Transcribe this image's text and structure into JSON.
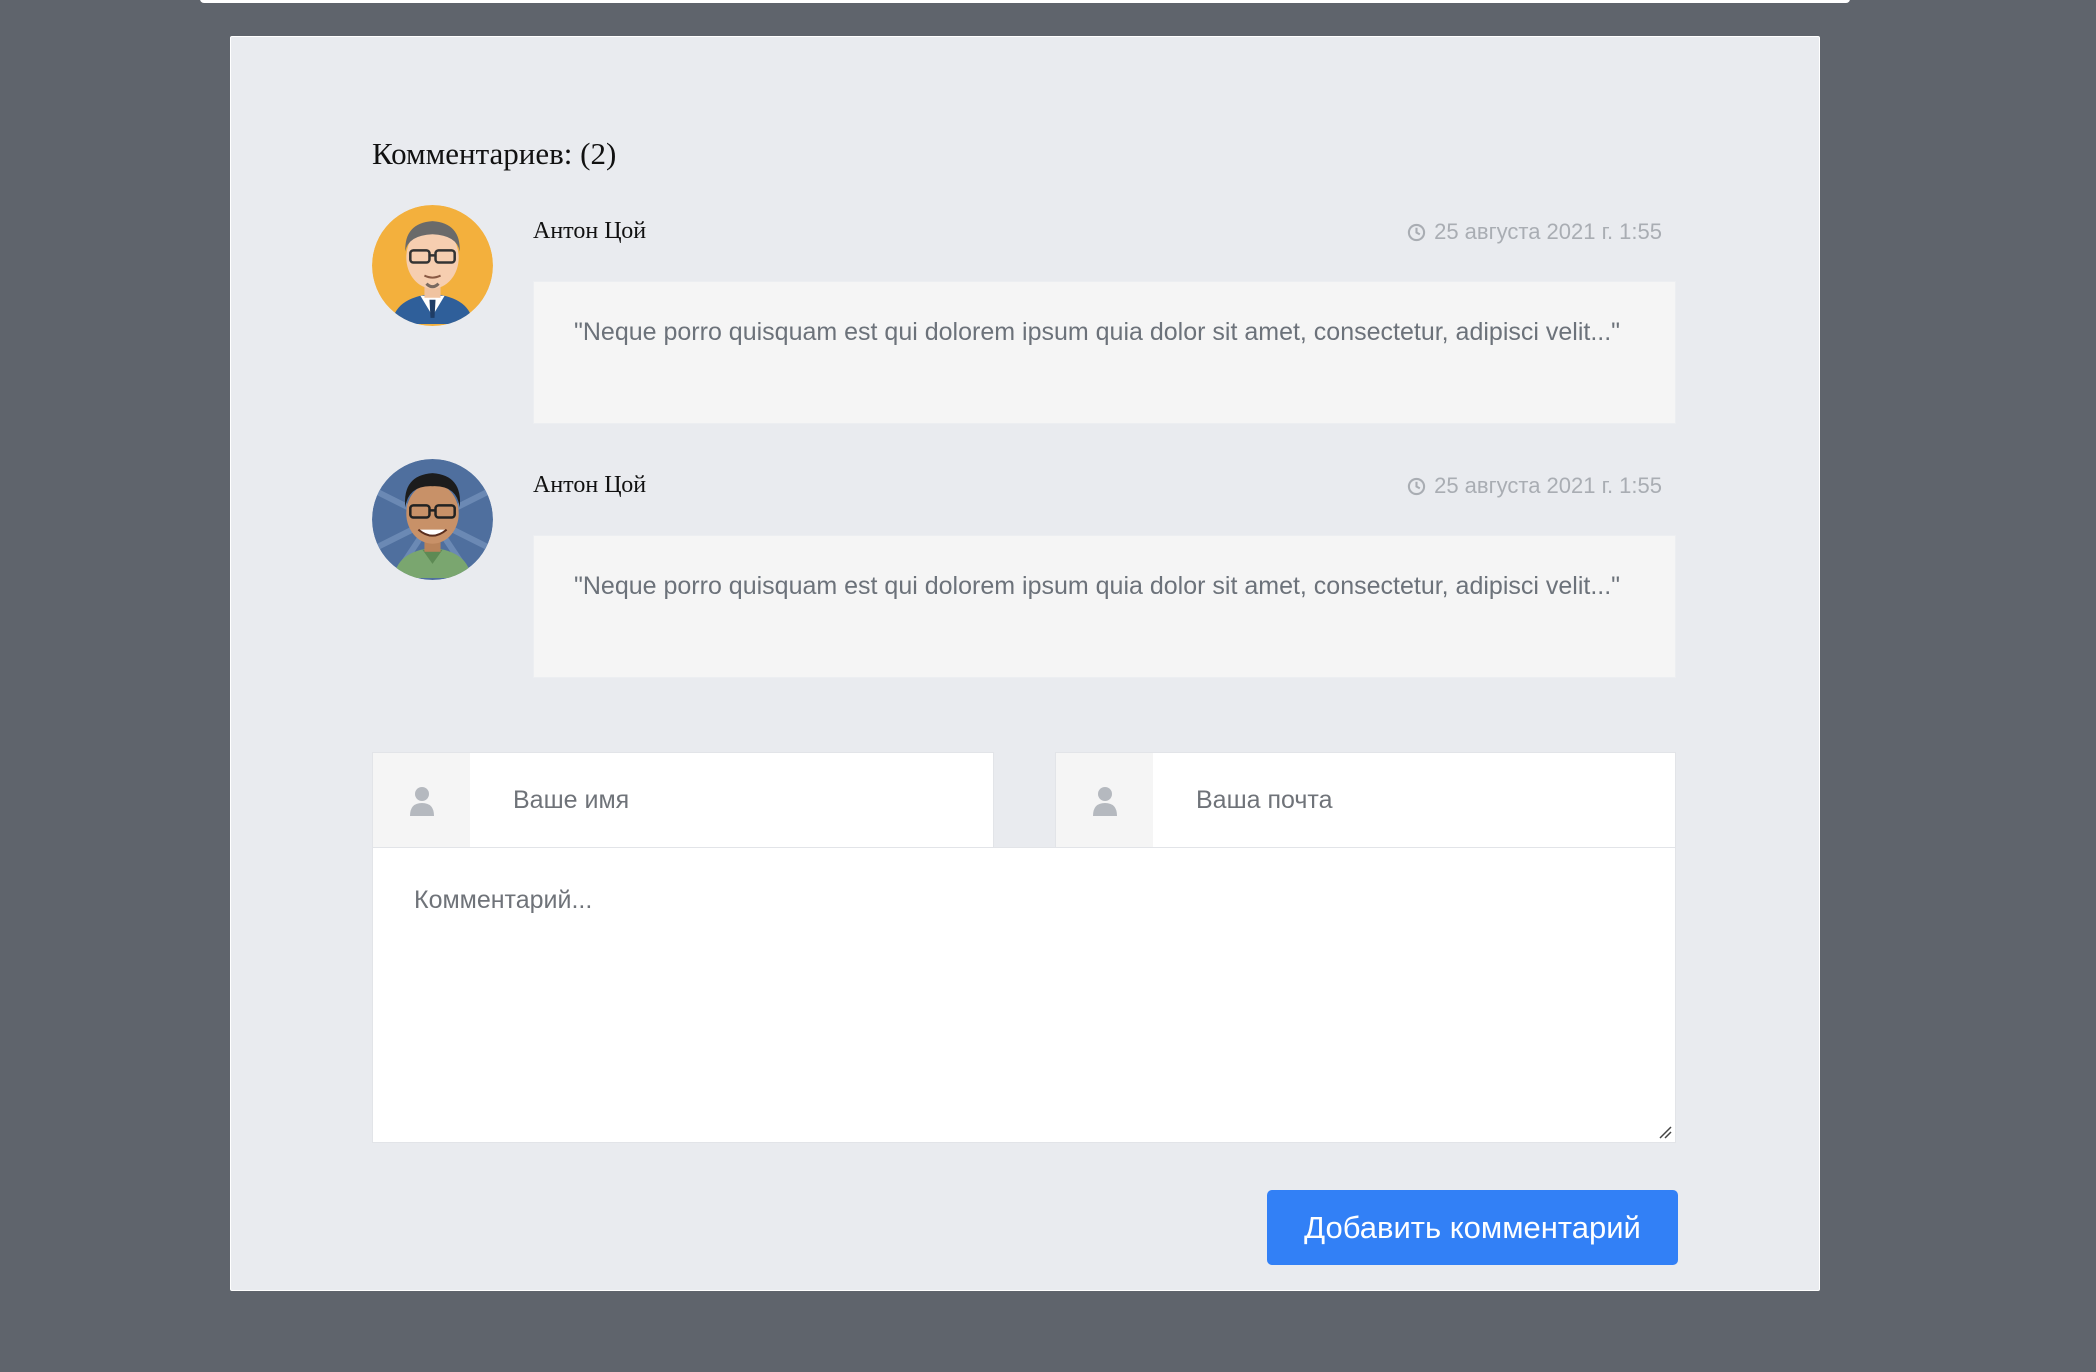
{
  "comments_section": {
    "title": "Комментариев: (2)",
    "comments": [
      {
        "author": "Антон Цой",
        "date": "25 августа 2021 г. 1:55",
        "text": "\"Neque porro quisquam est qui dolorem ipsum quia dolor sit amet, consectetur, adipisci velit...\"",
        "avatar_icon": "male-avatar-glasses-orange-bg"
      },
      {
        "author": "Антон Цой",
        "date": "25 августа 2021 г. 1:55",
        "text": "\"Neque porro quisquam est qui dolorem ipsum quia dolor sit amet, consectetur, adipisci velit...\"",
        "avatar_icon": "male-avatar-glasses-blue-bg"
      }
    ]
  },
  "form": {
    "name_placeholder": "Ваше имя",
    "email_placeholder": "Ваша почта",
    "comment_placeholder": "Комментарий...",
    "submit_label": "Добавить комментарий",
    "field_icon": "user-icon"
  },
  "colors": {
    "accent": "#3280f6",
    "page_background": "#5f646c",
    "card_background": "#e9ebef"
  }
}
